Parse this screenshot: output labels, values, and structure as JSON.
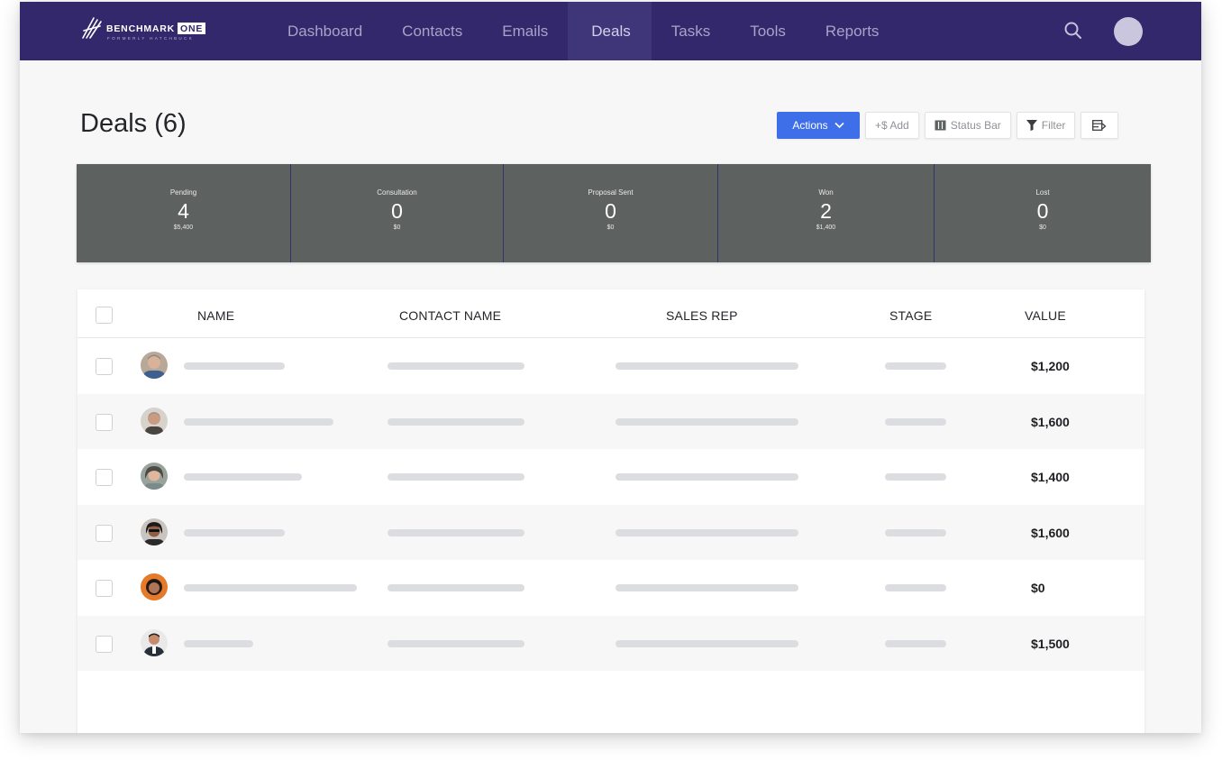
{
  "brand": {
    "name": "BENCHMARK",
    "suffix": "ONE",
    "tagline": "FORMERLY HATCHBUCK"
  },
  "nav": {
    "items": [
      {
        "label": "Dashboard",
        "active": false
      },
      {
        "label": "Contacts",
        "active": false
      },
      {
        "label": "Emails",
        "active": false
      },
      {
        "label": "Deals",
        "active": true
      },
      {
        "label": "Tasks",
        "active": false
      },
      {
        "label": "Tools",
        "active": false
      },
      {
        "label": "Reports",
        "active": false
      }
    ],
    "search_icon": "search-icon",
    "avatar_icon": "user-avatar"
  },
  "page": {
    "title": "Deals (6)"
  },
  "toolbar": {
    "actions_label": "Actions",
    "add_label": "+$ Add",
    "status_bar_label": "Status Bar",
    "filter_label": "Filter",
    "export_icon": "export-icon"
  },
  "colors": {
    "nav_bg": "#33286b",
    "primary": "#3f6fe8",
    "status_bg": "#5d6160"
  },
  "stages": [
    {
      "name": "Pending",
      "count": "4",
      "value": "$5,400"
    },
    {
      "name": "Consultation",
      "count": "0",
      "value": "$0"
    },
    {
      "name": "Proposal Sent",
      "count": "0",
      "value": "$0"
    },
    {
      "name": "Won",
      "count": "2",
      "value": "$1,400"
    },
    {
      "name": "Lost",
      "count": "0",
      "value": "$0"
    }
  ],
  "table": {
    "headers": {
      "name": "NAME",
      "contact_name": "CONTACT NAME",
      "sales_rep": "SALES REP",
      "stage": "STAGE",
      "value": "VALUE"
    },
    "rows": [
      {
        "value": "$1,200"
      },
      {
        "value": "$1,600"
      },
      {
        "value": "$1,400"
      },
      {
        "value": "$1,600"
      },
      {
        "value": "$0"
      },
      {
        "value": "$1,500"
      }
    ]
  }
}
